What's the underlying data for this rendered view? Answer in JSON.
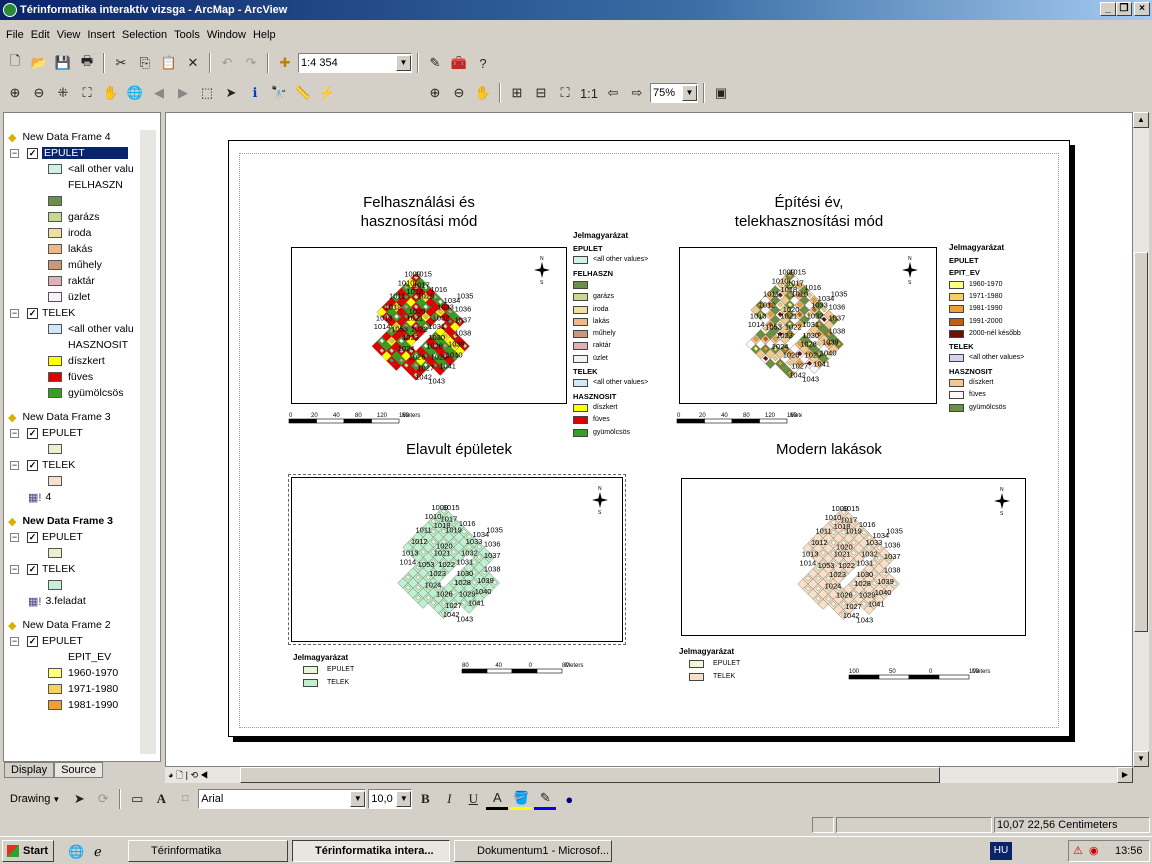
{
  "window": {
    "title": "Térinformatika interaktív vizsga - ArcMap - ArcView"
  },
  "menu": [
    "File",
    "Edit",
    "View",
    "Insert",
    "Selection",
    "Tools",
    "Window",
    "Help"
  ],
  "toolbar": {
    "scale": "1:4 354",
    "zoom": "75%"
  },
  "toc": {
    "tabs": [
      "Display",
      "Source"
    ],
    "rows": [
      {
        "type": "frame",
        "label": "New Data Frame 4",
        "bold": false
      },
      {
        "type": "layer",
        "label": "EPULET",
        "selected": true
      },
      {
        "type": "item",
        "label": "<all other valu",
        "color": "#d0f0e8"
      },
      {
        "type": "head",
        "label": "FELHASZN"
      },
      {
        "type": "item",
        "label": "",
        "color": "#6b8e4e"
      },
      {
        "type": "item",
        "label": "garázs",
        "color": "#c8d890"
      },
      {
        "type": "item",
        "label": "iroda",
        "color": "#f0e0a0"
      },
      {
        "type": "item",
        "label": "lakás",
        "color": "#f0b888"
      },
      {
        "type": "item",
        "label": "műhely",
        "color": "#c89878"
      },
      {
        "type": "item",
        "label": "raktár",
        "color": "#e0b0b8"
      },
      {
        "type": "item",
        "label": "üzlet",
        "color": "#f8f0f8"
      },
      {
        "type": "layer",
        "label": "TELEK"
      },
      {
        "type": "item",
        "label": "<all other valu",
        "color": "#d0e8f8"
      },
      {
        "type": "head",
        "label": "HASZNOSIT"
      },
      {
        "type": "item",
        "label": "díszkert",
        "color": "#ffff00"
      },
      {
        "type": "item",
        "label": "füves",
        "color": "#e00000"
      },
      {
        "type": "item",
        "label": "gyümölcsös",
        "color": "#38a020"
      },
      {
        "type": "gap"
      },
      {
        "type": "frame",
        "label": "New Data Frame 3",
        "bold": false
      },
      {
        "type": "layer",
        "label": "EPULET"
      },
      {
        "type": "item",
        "label": "",
        "color": "#e8f0d0"
      },
      {
        "type": "layer",
        "label": "TELEK"
      },
      {
        "type": "item",
        "label": "",
        "color": "#f8e0d0"
      },
      {
        "type": "table",
        "label": "4"
      },
      {
        "type": "gap"
      },
      {
        "type": "frame",
        "label": "New Data Frame 3",
        "bold": true
      },
      {
        "type": "layer",
        "label": "EPULET"
      },
      {
        "type": "item",
        "label": "",
        "color": "#e8f0d0"
      },
      {
        "type": "layer",
        "label": "TELEK"
      },
      {
        "type": "item",
        "label": "",
        "color": "#c8f0d8"
      },
      {
        "type": "table",
        "label": "3.feladat"
      },
      {
        "type": "gap"
      },
      {
        "type": "frame",
        "label": "New Data Frame 2",
        "bold": false
      },
      {
        "type": "layer",
        "label": "EPULET"
      },
      {
        "type": "head",
        "label": "EPIT_EV"
      },
      {
        "type": "item",
        "label": "1960-1970",
        "color": "#ffff80"
      },
      {
        "type": "item",
        "label": "1971-1980",
        "color": "#f8d060"
      },
      {
        "type": "item",
        "label": "1981-1990",
        "color": "#f0a030"
      }
    ]
  },
  "maps": [
    {
      "title1": "Felhasználási és",
      "title2": "hasznosítási mód"
    },
    {
      "title1": "Építési év,",
      "title2": "telekhasznosítási mód"
    },
    {
      "title1": "Elavult épületek",
      "title2": ""
    },
    {
      "title1": "Modern lakások",
      "title2": ""
    }
  ],
  "legend1": {
    "title": "Jelmagyarázat",
    "rows": [
      {
        "t": "EPULET",
        "h": true
      },
      {
        "t": "<all other values>",
        "c": "#d0f0e8"
      },
      {
        "t": "FELHASZN",
        "h": true
      },
      {
        "t": "",
        "c": "#6b8e4e"
      },
      {
        "t": "garázs",
        "c": "#c8d890"
      },
      {
        "t": "iroda",
        "c": "#f0e0a0"
      },
      {
        "t": "lakás",
        "c": "#f0b888"
      },
      {
        "t": "műhely",
        "c": "#c89878"
      },
      {
        "t": "raktár",
        "c": "#e0b0b8"
      },
      {
        "t": "üzlet",
        "c": "#f8f0f8"
      },
      {
        "t": "TELEK",
        "h": true
      },
      {
        "t": "<all other values>",
        "c": "#d0e8f8"
      },
      {
        "t": "HASZNOSIT",
        "h": true
      },
      {
        "t": "díszkert",
        "c": "#ffff00"
      },
      {
        "t": "füves",
        "c": "#e00000"
      },
      {
        "t": "gyümölcsös",
        "c": "#38a020"
      }
    ]
  },
  "legend2": {
    "title": "Jelmagyarázat",
    "rows": [
      {
        "t": "EPULET",
        "h": true
      },
      {
        "t": "EPIT_EV",
        "h": true
      },
      {
        "t": "1960-1970",
        "c": "#ffff80"
      },
      {
        "t": "1971-1980",
        "c": "#f8d060"
      },
      {
        "t": "1981-1990",
        "c": "#f0a030"
      },
      {
        "t": "1991-2000",
        "c": "#c06010"
      },
      {
        "t": "2000-nél később",
        "c": "#701000"
      },
      {
        "t": "TELEK",
        "h": true
      },
      {
        "t": "<all other values>",
        "c": "#d8d0f0"
      },
      {
        "t": "HASZNOSIT",
        "h": true
      },
      {
        "t": "díszkert",
        "c": "#f0c890"
      },
      {
        "t": "füves",
        "c": "#fff8f8"
      },
      {
        "t": "gyümölcsös",
        "c": "#6b9040"
      }
    ]
  },
  "legend3": {
    "title": "Jelmagyarázat",
    "rows": [
      {
        "t": "EPULET",
        "c": "#e8f8d0"
      },
      {
        "t": "TELEK",
        "c": "#c0f0d0"
      }
    ]
  },
  "legend4": {
    "title": "Jelmagyarázat",
    "rows": [
      {
        "t": "EPULET",
        "c": "#eef8d8"
      },
      {
        "t": "TELEK",
        "c": "#f8e0c8"
      }
    ]
  },
  "scalebars": {
    "s1": [
      "0",
      "20",
      "40",
      "80",
      "120",
      "160",
      "Meters"
    ],
    "s3": [
      "80",
      "40",
      "0",
      "80",
      "Meters"
    ],
    "s4": [
      "100",
      "50",
      "0",
      "100",
      "Meters"
    ]
  },
  "parcels": [
    "1009",
    "1015",
    "1010",
    "1017",
    "1016",
    "1011",
    "1019",
    "1018",
    "1035",
    "1034",
    "1012",
    "1020",
    "1033",
    "1036",
    "1013",
    "1021",
    "1032",
    "1014",
    "1053",
    "1022",
    "1031",
    "1037",
    "1023",
    "1030",
    "1038",
    "1024",
    "1028",
    "1039",
    "1026",
    "1029",
    "1040",
    "1027",
    "1041",
    "1042",
    "1043"
  ],
  "drawing": {
    "label": "Drawing",
    "font": "Arial",
    "size": "10,0"
  },
  "status": {
    "coords": "10,07  22,56 Centimeters"
  },
  "taskbar": {
    "start": "Start",
    "tasks": [
      "Térinformatika",
      "Térinformatika intera...",
      "Dokumentum1 - Microsof..."
    ],
    "lang": "HU",
    "time": "13:56"
  }
}
